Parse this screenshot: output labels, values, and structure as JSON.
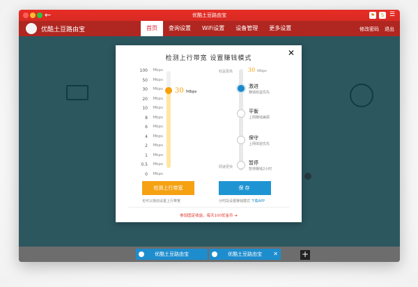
{
  "window": {
    "title": "优酷土豆路由宝",
    "back_glyph": "←",
    "toolbar_icons": [
      "flag-icon",
      "s-icon",
      "menu-icon"
    ]
  },
  "navbar": {
    "brand": "优酷土豆路由宝",
    "tabs": [
      {
        "label": "首页",
        "active": true
      },
      {
        "label": "查询设置",
        "active": false
      },
      {
        "label": "WiFi设置",
        "active": false
      },
      {
        "label": "设备管理",
        "active": false
      },
      {
        "label": "更多设置",
        "active": false
      }
    ],
    "right_link": "修改密码",
    "right_link2": "退出"
  },
  "dialog": {
    "title": "检测上行带宽  设置赚钱模式",
    "close": "✕",
    "bandwidth": {
      "ticks": [
        "100",
        "50",
        "30",
        "20",
        "10",
        "8",
        "6",
        "4",
        "2",
        "1",
        "0.5",
        "0"
      ],
      "tick_unit": "Mbps",
      "value": "30",
      "value_unit": "Mbps"
    },
    "mode": {
      "top_left_label": "收益更高",
      "top_value": "30",
      "top_value_unit": "Mbps",
      "bottom_left_label": "网速更快",
      "options": [
        {
          "name": "激进",
          "desc": "赚钱收益优先",
          "selected": true
        },
        {
          "name": "平衡",
          "desc": "上网赚钱兼顾",
          "selected": false
        },
        {
          "name": "保守",
          "desc": "上网体验优先",
          "selected": false
        },
        {
          "name": "暂停",
          "desc": "暂停赚钱2小时",
          "selected": false
        }
      ]
    },
    "detect_button": "检测上行带宽",
    "save_button": "保存",
    "detect_hint": "也可以拖动设置上行带宽",
    "save_hint": "分时段设置赚钱模式",
    "save_hint_link": "下载APP",
    "promo": "参加固定收益，每天100优金币 ➔"
  },
  "dock": {
    "tabs": [
      {
        "label": "优酷土豆路由宝"
      },
      {
        "label": "优酷土豆路由宝"
      }
    ],
    "close_glyph": "✕",
    "add_glyph": "+"
  },
  "colors": {
    "titlebar": "#e72d25",
    "overlay": "#0a3c46",
    "accent_orange": "#f5a112",
    "accent_blue": "#1f94d2"
  }
}
